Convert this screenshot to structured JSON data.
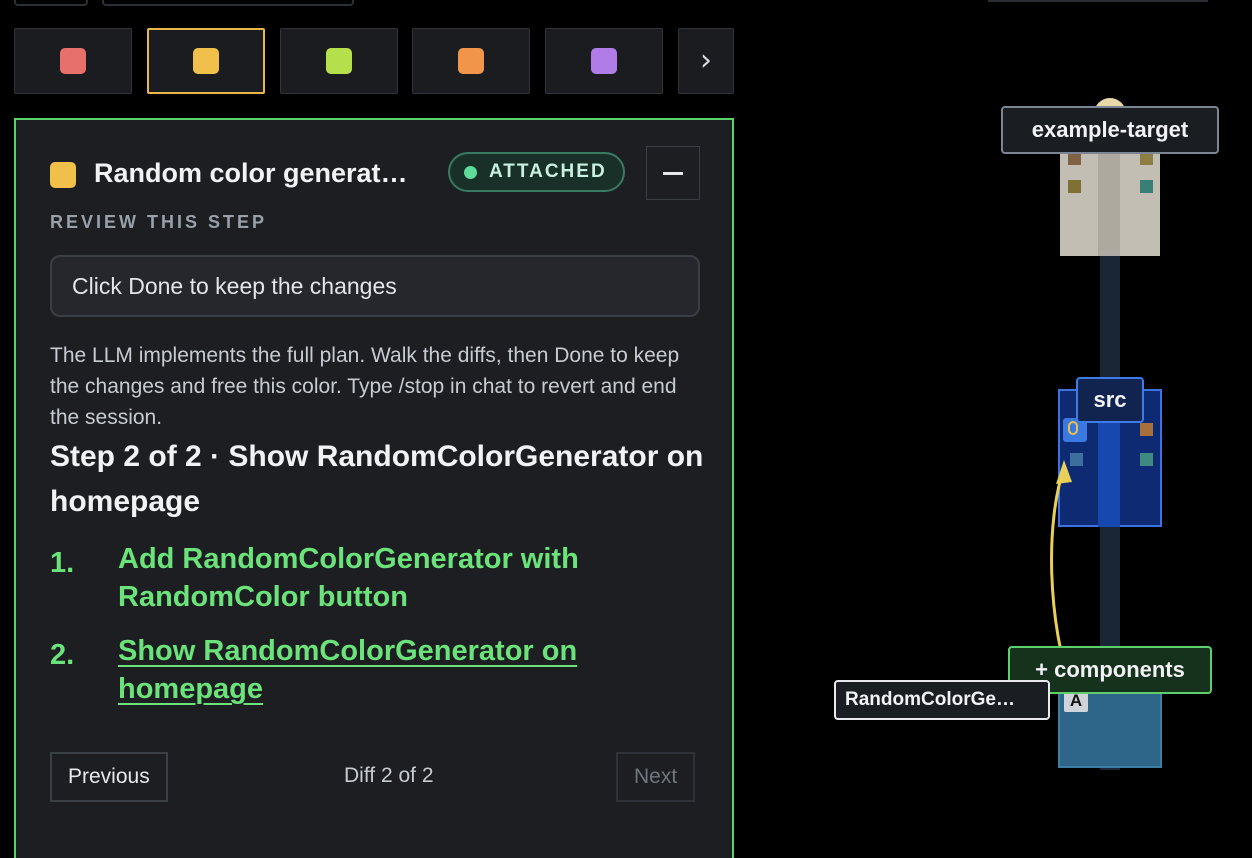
{
  "tabs": [
    {
      "color": "#e8706a",
      "active": false
    },
    {
      "color": "#f0c04a",
      "active": true
    },
    {
      "color": "#b5e04c",
      "active": false
    },
    {
      "color": "#f0954a",
      "active": false
    },
    {
      "color": "#b07ce8",
      "active": false
    }
  ],
  "panel": {
    "accent": "#59d26a",
    "chip_color": "#f0c04a",
    "title": "Random color generat…",
    "badge": "ATTACHED",
    "section_label": "REVIEW THIS STEP",
    "instruction": "Click Done to keep the changes",
    "description": "The LLM implements the full plan. Walk the diffs, then Done to keep the changes and free this color. Type /stop in chat to revert and end the session.",
    "step_title": "Step 2 of 2 · Show RandomColorGenerator on homepage",
    "steps": [
      {
        "num": "1.",
        "text": "Add RandomColorGenerator with RandomColor button"
      },
      {
        "num": "2.",
        "text": "Show RandomColorGenerator on homepage"
      }
    ],
    "footer": {
      "previous": "Previous",
      "diff": "Diff 2 of 2",
      "next": "Next"
    }
  },
  "graph": {
    "target_label": "example-target",
    "src_label": "src",
    "components_label": "+ components",
    "file_label": "RandomColorGe…",
    "cursor_glyph": "A"
  }
}
